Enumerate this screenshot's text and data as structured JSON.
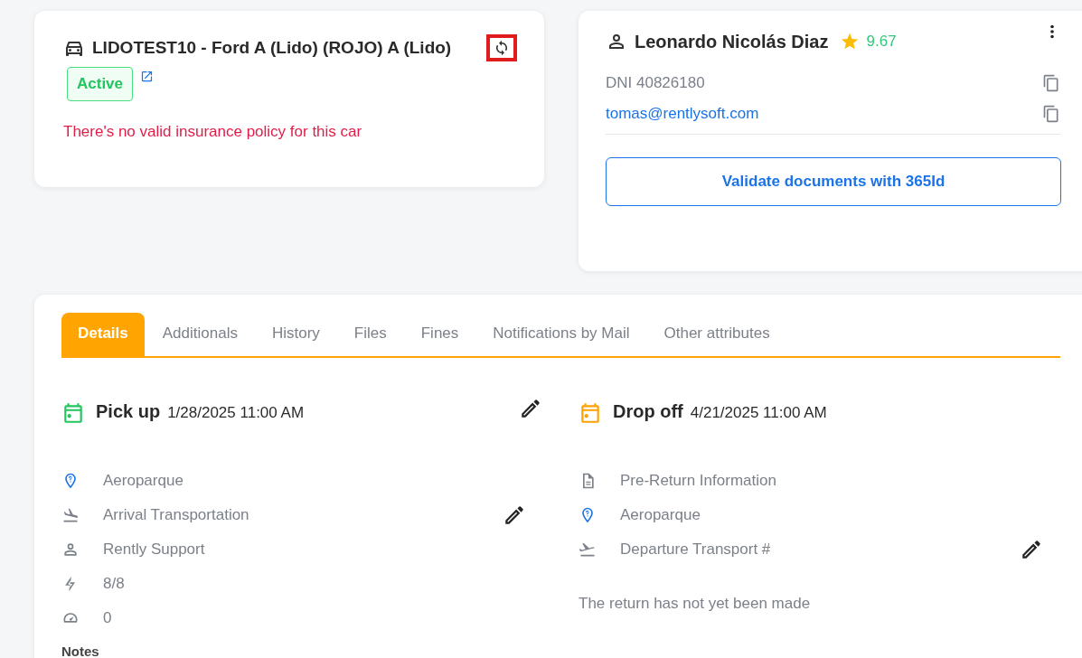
{
  "vehicle": {
    "title": "LIDOTEST10 - Ford A (Lido) (ROJO) A (Lido)",
    "refresh_highlighted": true,
    "status": "Active",
    "warning": "There's no valid insurance policy for this car"
  },
  "customer": {
    "name": "Leonardo Nicolás Diaz",
    "rating": "9.67",
    "dni": "DNI 40826180",
    "email": "tomas@rentlysoft.com",
    "validate_button": "Validate documents with 365Id"
  },
  "tabs": [
    {
      "label": "Details",
      "selected": true
    },
    {
      "label": "Additionals",
      "selected": false
    },
    {
      "label": "History",
      "selected": false
    },
    {
      "label": "Files",
      "selected": false
    },
    {
      "label": "Fines",
      "selected": false
    },
    {
      "label": "Notifications by Mail",
      "selected": false
    },
    {
      "label": "Other attributes",
      "selected": false
    }
  ],
  "pickup": {
    "label": "Pick up",
    "datetime": "1/28/2025 11:00 AM",
    "color": "#22c55e",
    "rows": [
      {
        "kind": "location",
        "text": "Aeroparque",
        "editable": false
      },
      {
        "kind": "arrival",
        "text": "Arrival Transportation",
        "editable": true
      },
      {
        "kind": "person",
        "text": "Rently Support",
        "editable": false
      },
      {
        "kind": "fuel",
        "text": "8/8",
        "editable": false
      },
      {
        "kind": "odometer",
        "text": "0",
        "editable": false
      }
    ],
    "notes_label": "Notes"
  },
  "dropoff": {
    "label": "Drop off",
    "datetime": "4/21/2025 11:00 AM",
    "color": "#ffa000",
    "rows": [
      {
        "kind": "document",
        "text": "Pre-Return Information",
        "editable": false
      },
      {
        "kind": "location",
        "text": "Aeroparque",
        "editable": false
      },
      {
        "kind": "departure",
        "text": "Departure Transport #",
        "editable": true
      }
    ],
    "note": "The return has not yet been made"
  }
}
